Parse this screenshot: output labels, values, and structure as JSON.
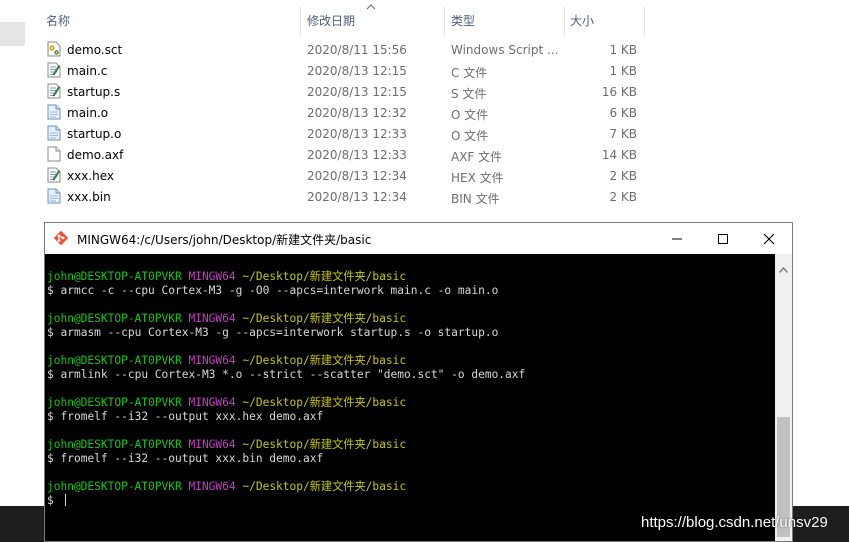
{
  "explorer": {
    "columns": {
      "name": "名称",
      "date": "修改日期",
      "type": "类型",
      "size": "大小"
    },
    "files": [
      {
        "name": "demo.sct",
        "date": "2020/8/11 15:56",
        "type": "Windows Script ...",
        "size": "1 KB",
        "icon": "script-file-icon"
      },
      {
        "name": "main.c",
        "date": "2020/8/13 12:15",
        "type": "C 文件",
        "size": "1 KB",
        "icon": "source-file-icon"
      },
      {
        "name": "startup.s",
        "date": "2020/8/13 12:15",
        "type": "S 文件",
        "size": "16 KB",
        "icon": "source-file-icon"
      },
      {
        "name": "main.o",
        "date": "2020/8/13 12:32",
        "type": "O 文件",
        "size": "6 KB",
        "icon": "object-file-icon"
      },
      {
        "name": "startup.o",
        "date": "2020/8/13 12:33",
        "type": "O 文件",
        "size": "7 KB",
        "icon": "object-file-icon"
      },
      {
        "name": "demo.axf",
        "date": "2020/8/13 12:33",
        "type": "AXF 文件",
        "size": "14 KB",
        "icon": "blank-file-icon"
      },
      {
        "name": "xxx.hex",
        "date": "2020/8/13 12:34",
        "type": "HEX 文件",
        "size": "2 KB",
        "icon": "source-file-icon"
      },
      {
        "name": "xxx.bin",
        "date": "2020/8/13 12:34",
        "type": "BIN 文件",
        "size": "2 KB",
        "icon": "object-file-icon"
      }
    ]
  },
  "terminal": {
    "title": "MINGW64:/c/Users/john/Desktop/新建文件夹/basic",
    "prompt": {
      "user": "john@DESKTOP-AT0PVKR",
      "host": "MINGW64",
      "path": "~/Desktop/新建文件夹/basic",
      "symbol": "$"
    },
    "commands": [
      "armcc -c --cpu Cortex-M3 -g -O0 --apcs=interwork main.c -o main.o",
      "armasm --cpu Cortex-M3 -g --apcs=interwork startup.s -o startup.o",
      "armlink --cpu Cortex-M3 *.o --strict --scatter \"demo.sct\" -o demo.axf",
      "fromelf --i32 --output xxx.hex demo.axf",
      "fromelf --i32 --output xxx.bin demo.axf"
    ]
  },
  "watermark": "https://blog.csdn.net/unsv29",
  "colors": {
    "prompt_user": "#14c814",
    "prompt_host": "#c33ec3",
    "prompt_path": "#c8c800",
    "console_bg": "#000000"
  }
}
